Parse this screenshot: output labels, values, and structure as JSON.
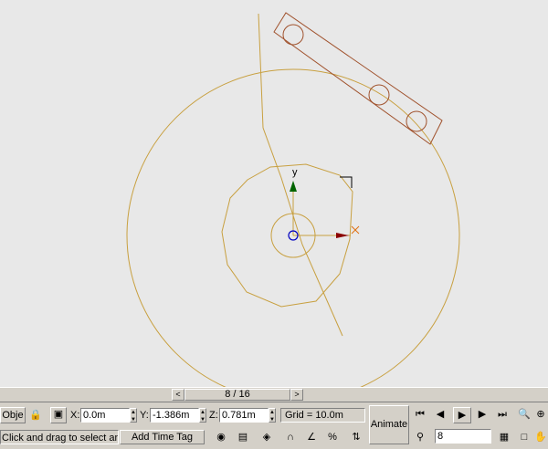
{
  "timebar": {
    "frame_indicator": "8 / 16",
    "prev_label": "<",
    "next_label": ">"
  },
  "coords": {
    "object_label": "Obje",
    "x_label": "X:",
    "x_value": "0.0m",
    "y_label": "Y:",
    "y_value": "-1.386m",
    "z_label": "Z:",
    "z_value": "0.781m",
    "grid": "Grid = 10.0m"
  },
  "status": {
    "prompt": "Click and drag to select and m",
    "add_time_tag": "Add Time Tag"
  },
  "animate": {
    "label": "Animate",
    "current_frame": "8"
  },
  "gizmo": {
    "y_axis": "y"
  },
  "colors": {
    "wire": "#c8a040",
    "bar": "#a0522d",
    "viewport_bg": "#e8e8e8",
    "chrome": "#d4d0c8"
  }
}
